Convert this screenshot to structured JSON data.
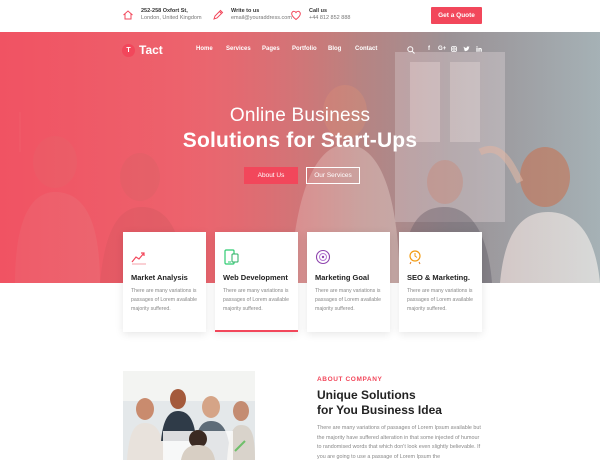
{
  "topbar": {
    "address": {
      "line1": "252-258 Oxfort St,",
      "line2": "London, United Kingdom"
    },
    "email": {
      "line1": "Write to us",
      "line2": "email@youraddress.com"
    },
    "phone": {
      "line1": "Call us",
      "line2": "+44 812 852 888"
    },
    "quote_button": "Get a Quote"
  },
  "header": {
    "logo_mark": "T",
    "logo_name": "Tact",
    "nav": [
      "Home",
      "Services",
      "Pages",
      "Portfolio",
      "Blog",
      "Contact"
    ],
    "social": [
      "f",
      "G+",
      "ig",
      "tw",
      "in"
    ]
  },
  "hero": {
    "subtitle": "Online Business",
    "title": "Solutions for Start-Ups",
    "primary_button": "About Us",
    "secondary_button": "Our Services"
  },
  "cards": [
    {
      "title": "Market Analysis",
      "desc": "There are many variations is passages of Lorem available majority suffered.",
      "icon": "market-analysis-icon",
      "color": "#f2475b"
    },
    {
      "title": "Web Development",
      "desc": "There are many variations is passages of Lorem available majority suffered.",
      "icon": "web-development-icon",
      "color": "#2ecc71"
    },
    {
      "title": "Marketing Goal",
      "desc": "There are many variations is passages of Lorem available majority suffered.",
      "icon": "marketing-goal-icon",
      "color": "#8e44ad"
    },
    {
      "title": "SEO & Marketing.",
      "desc": "There are many variations is passages of Lorem available majority suffered.",
      "icon": "seo-marketing-icon",
      "color": "#f39c12"
    }
  ],
  "about": {
    "kicker": "ABOUT COMPANY",
    "title_line1": "Unique Solutions",
    "title_line2": "for You Business Idea",
    "text": "There are many variations of passages of Lorem Ipsum available but the majority have suffered alteration in that  some injected of humour to randomised words that which don't look even slightly believable. If you are going to use a passage of Lorem Ipsum the"
  },
  "colors": {
    "accent": "#f2475b"
  }
}
